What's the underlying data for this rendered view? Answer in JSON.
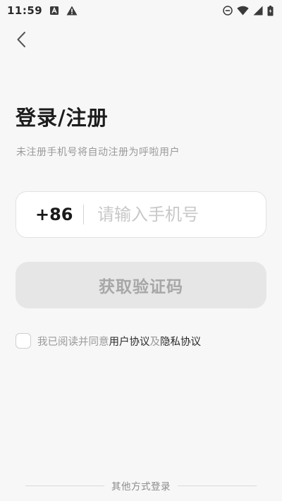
{
  "status_bar": {
    "time": "11:59",
    "icons_left": [
      "a-notification-icon",
      "warning-icon"
    ],
    "icons_right": [
      "do-not-disturb-icon",
      "wifi-icon",
      "signal-icon",
      "battery-icon"
    ]
  },
  "header": {
    "back_icon": "chevron-left-icon"
  },
  "login": {
    "title": "登录/注册",
    "subtitle": "未注册手机号将自动注册为呼啦用户",
    "country_code": "+86",
    "phone_placeholder": "请输入手机号",
    "phone_value": "",
    "get_code_label": "获取验证码"
  },
  "agreement": {
    "checked": false,
    "prefix": "我已阅读并同意",
    "user_agreement": "用户协议",
    "conjunction": "及",
    "privacy_policy": "隐私协议"
  },
  "footer": {
    "other_login_label": "其他方式登录"
  },
  "colors": {
    "background": "#f7f7f7",
    "button_disabled_bg": "#e6e6e6",
    "button_disabled_text": "#a7a7a7",
    "muted_text": "#9a9a9a"
  }
}
